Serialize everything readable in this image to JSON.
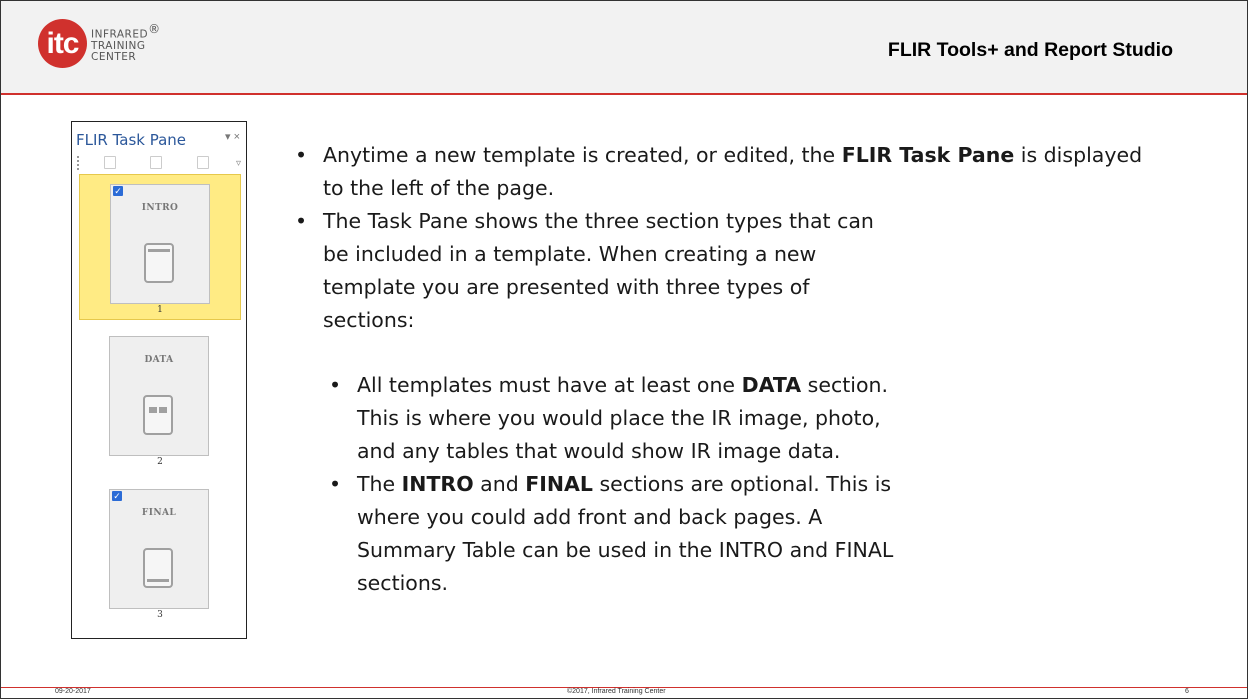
{
  "header": {
    "logo_mark": "itc",
    "logo_line1": "INFRARED",
    "logo_registered": "®",
    "logo_line2": "TRAINING",
    "logo_line3": "CENTER",
    "title": "FLIR Tools+ and Report Studio"
  },
  "task_pane": {
    "title": "FLIR Task Pane",
    "dropdown_glyph": "▾",
    "close_glyph": "×",
    "sections": [
      {
        "label": "INTRO",
        "number": "1",
        "checked": true,
        "selected": true
      },
      {
        "label": "DATA",
        "number": "2",
        "checked": false,
        "selected": false
      },
      {
        "label": "FINAL",
        "number": "3",
        "checked": true,
        "selected": false
      }
    ]
  },
  "content": {
    "bullets": [
      {
        "pre": "Anytime a new template is created, or edited, the ",
        "bold": "FLIR Task Pane",
        "post": " is displayed to the left of the page."
      },
      {
        "text": "The Task Pane shows the three section types that can be included in a template.  When creating a new template you are presented with three types of sections:"
      }
    ],
    "sub_bullets": [
      {
        "pre": "All templates must have at least one ",
        "bold": "DATA",
        "post": " section.  This is where you would place the IR image, photo, and any tables that would show IR image data."
      },
      {
        "pre": "The ",
        "bold": "INTRO",
        "mid": " and ",
        "bold2": "FINAL",
        "post": " sections are optional.  This is where you could add front and back pages.  A Summary Table can be used in the INTRO and FINAL sections."
      }
    ]
  },
  "footer": {
    "date": "09-20-2017",
    "copyright": "©2017, Infrared Training Center",
    "page": "6"
  },
  "colors": {
    "accent": "#d0312d",
    "selection": "#ffeb84",
    "pane_title": "#2b579a",
    "checkbox": "#2b6bd6"
  }
}
